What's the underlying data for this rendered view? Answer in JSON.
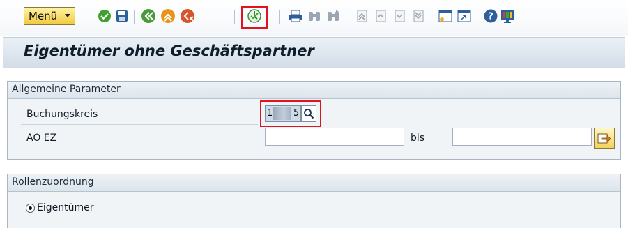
{
  "toolbar": {
    "menu_label": "Menü",
    "icons": [
      "check-icon",
      "save-icon",
      "back-icon",
      "exit-icon",
      "cancel-icon",
      "execute-icon",
      "print-icon",
      "find-icon",
      "find-next-icon",
      "first-page-icon",
      "previous-page-icon",
      "next-page-icon",
      "last-page-icon",
      "create-session-icon",
      "shortcut-icon",
      "help-icon",
      "customize-layout-icon"
    ]
  },
  "title": "Eigentümer ohne Geschäftspartner",
  "general_params": {
    "title": "Allgemeine Parameter",
    "company_code_label": "Buchungskreis",
    "company_code_value_start": "1",
    "company_code_value_end": "5",
    "ao_ez_label": "AO EZ",
    "ao_ez_from": "",
    "to_label": "bis",
    "ao_ez_to": ""
  },
  "role_assignment": {
    "title": "Rollenzuordnung",
    "owner_label": "Eigentümer",
    "owner_selected": true
  },
  "colors": {
    "highlight": "#e0141e",
    "accent_yellow": "#f1c93b",
    "title_bg": "#d3dde7"
  }
}
